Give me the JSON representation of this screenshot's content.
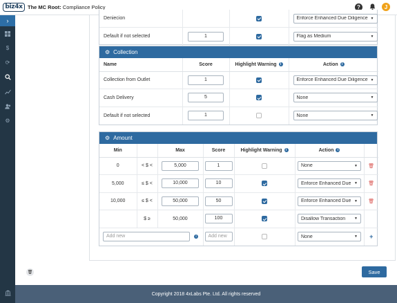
{
  "app": {
    "logo_text": "biz4x",
    "title_bold": "The MC Root:",
    "title_rest": " Compliance Policy",
    "help_icon": "?",
    "avatar_initial": "J"
  },
  "top_section": {
    "partial_row": {
      "name": "Deniecion",
      "score": "",
      "highlight": true,
      "action": "Enforce Enhanced Due Diligence"
    },
    "default_row": {
      "name": "Default if not selected",
      "score": "1",
      "highlight": true,
      "action": "Flag as Medium"
    }
  },
  "collection": {
    "title": "Collection",
    "headers": {
      "name": "Name",
      "score": "Score",
      "highlight": "Highlight Warning",
      "action": "Action"
    },
    "rows": [
      {
        "name": "Collection from Outlet",
        "score": "1",
        "highlight": true,
        "action": "Enforce Enhanced Due Diligence"
      },
      {
        "name": "Cash Delivery",
        "score": "5",
        "highlight": true,
        "action": "None"
      },
      {
        "name": "Default if not selected",
        "score": "1",
        "highlight": false,
        "action": "None"
      }
    ]
  },
  "amount": {
    "title": "Amount",
    "headers": {
      "min": "Min",
      "max": "Max",
      "score": "Score",
      "highlight": "Highlight Warning",
      "action": "Action"
    },
    "rows": [
      {
        "min": "0",
        "op": "< $ <",
        "max": "5,000",
        "score": "1",
        "highlight": false,
        "action": "None"
      },
      {
        "min": "5,000",
        "op": "≤ $ <",
        "max": "10,000",
        "score": "10",
        "highlight": true,
        "action": "Enforce Enhanced Due D"
      },
      {
        "min": "10,000",
        "op": "≤ $ <",
        "max": "50,000",
        "score": "50",
        "highlight": true,
        "action": "Enforce Enhanced Due D"
      },
      {
        "min": "",
        "op": "$ ≥",
        "max": "50,000",
        "score": "100",
        "highlight": true,
        "action": "Disallow Transaction"
      }
    ],
    "new_row": {
      "max_placeholder": "Add new",
      "score_placeholder": "Add new",
      "action": "None"
    }
  },
  "footer": {
    "save_label": "Save",
    "copyright": "Copyright 2018 4xLabs Pte. Ltd. All rights reserved"
  },
  "colors": {
    "accent": "#2e6aa0",
    "sidebar": "#233645",
    "footer": "#4a6078",
    "danger": "#d9534f"
  }
}
